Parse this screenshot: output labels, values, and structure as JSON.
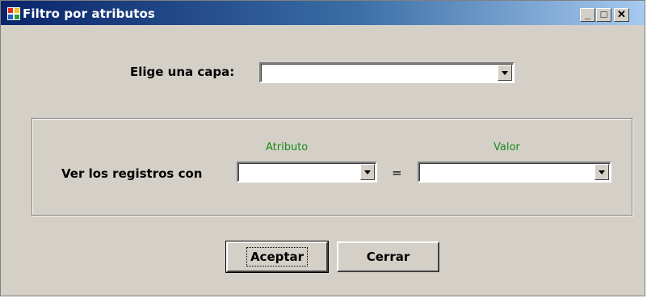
{
  "window": {
    "title": "Filtro por atributos",
    "controls": {
      "minimize": "_",
      "maximize": "□",
      "close": "✕"
    }
  },
  "layer": {
    "label": "Elige una capa:",
    "selected": ""
  },
  "filter": {
    "row_label": "Ver los registros con",
    "attribute_header": "Atributo",
    "attribute_selected": "",
    "equals": "=",
    "value_header": "Valor",
    "value_selected": ""
  },
  "buttons": {
    "accept": "Aceptar",
    "close": "Cerrar"
  },
  "colors": {
    "header_green": "#1a8a1a",
    "titlebar_start": "#0a246a",
    "face": "#d4d0c8"
  }
}
